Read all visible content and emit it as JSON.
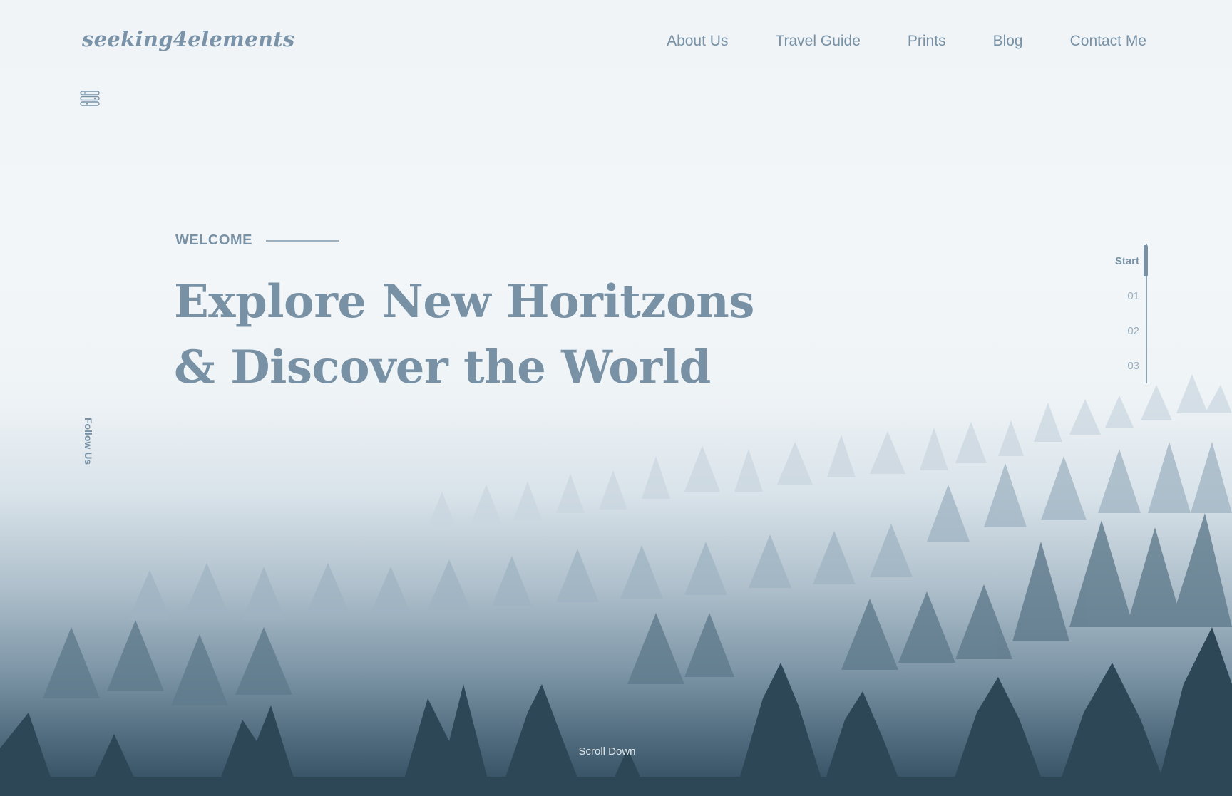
{
  "logo": {
    "text": "seeking4elements"
  },
  "nav": {
    "items": [
      {
        "label": "About Us"
      },
      {
        "label": "Travel Guide"
      },
      {
        "label": "Prints"
      },
      {
        "label": "Blog"
      },
      {
        "label": "Contact Me"
      }
    ]
  },
  "menu": {
    "icon": "menu-icon"
  },
  "hero": {
    "eyebrow": "WELCOME",
    "headline_line1": "Explore New Horitzons",
    "headline_line2": "& Discover the World",
    "background": "misty-pine-forest-image"
  },
  "social": {
    "follow_label": "Follow Us"
  },
  "pager": {
    "items": [
      {
        "label": "Start",
        "active": true
      },
      {
        "label": "01",
        "active": false
      },
      {
        "label": "02",
        "active": false
      },
      {
        "label": "03",
        "active": false
      }
    ]
  },
  "scroll": {
    "label": "Scroll Down"
  },
  "colors": {
    "accent": "#7891a5",
    "pager_inactive": "#9aaebd",
    "scroll_text": "#dfe7ec"
  }
}
